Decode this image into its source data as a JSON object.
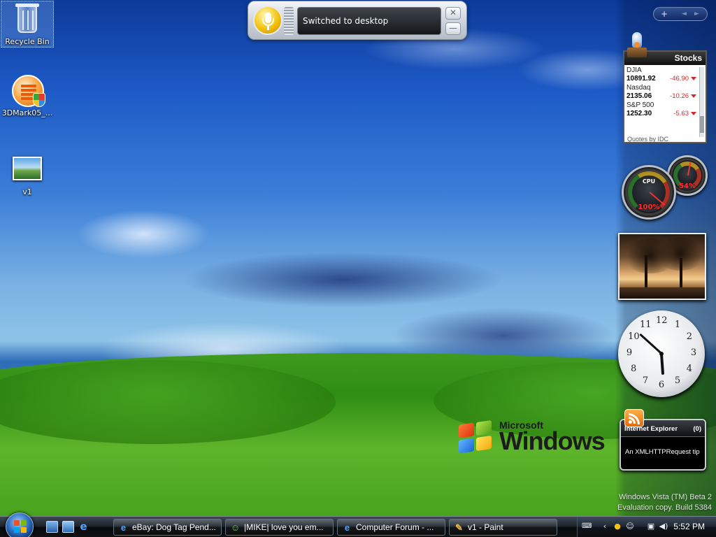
{
  "desktop": {
    "icons": [
      {
        "label": "Recycle Bin",
        "icon": "recycle-bin-icon"
      },
      {
        "label": "3DMark05_...",
        "icon": "3dmark-icon"
      },
      {
        "label": "v1",
        "icon": "image-file-icon"
      }
    ],
    "watermark": {
      "line1": "Windows Vista (TM) Beta 2",
      "line2": "Evaluation copy. Build 5384"
    },
    "logo": {
      "microsoft": "Microsoft",
      "windows": "Windows"
    }
  },
  "speech_bar": {
    "status": "Switched to desktop",
    "close_label": "✕",
    "minimize_label": "—",
    "accent": "#f4c20d"
  },
  "sidebar": {
    "controls": {
      "add": "+",
      "prev": "◄",
      "next": "►"
    },
    "stocks": {
      "title": "Stocks",
      "quotes": [
        {
          "symbol": "DJIA",
          "price": "10891.92",
          "change": "-46.90"
        },
        {
          "symbol": "Nasdaq",
          "price": "2135.06",
          "change": "-10.26"
        },
        {
          "symbol": "S&P 500",
          "price": "1252.30",
          "change": "-5.63"
        }
      ],
      "footer": "Quotes by IDC",
      "down_color": "#d0282b"
    },
    "meter": {
      "cpu_label": "CPU",
      "cpu_value": "100%",
      "cpu_percent": 100,
      "mem_value": "54%",
      "mem_percent": 54
    },
    "clock": {
      "numbers": [
        "12",
        "1",
        "2",
        "3",
        "4",
        "5",
        "6",
        "7",
        "8",
        "9",
        "10",
        "11"
      ],
      "hour": 5,
      "minute": 52
    },
    "feed": {
      "title": "Internet Explorer",
      "count": "(0)",
      "headline": "An XMLHTTPRequest tip"
    }
  },
  "taskbar": {
    "quick_launch": [
      {
        "name": "show-desktop",
        "icon": "show-desktop-icon"
      },
      {
        "name": "switch-windows",
        "icon": "switch-windows-icon"
      },
      {
        "name": "internet-explorer",
        "icon": "ie-icon"
      }
    ],
    "tasks": [
      {
        "label": "eBay: Dog Tag Pend...",
        "icon": "ie-icon"
      },
      {
        "label": "|MIKE|   love you em...",
        "icon": "messenger-icon"
      },
      {
        "label": "Computer Forum - ...",
        "icon": "ie-icon"
      },
      {
        "label": "v1 - Paint",
        "icon": "paint-icon"
      }
    ],
    "clock": "5:52 PM"
  }
}
